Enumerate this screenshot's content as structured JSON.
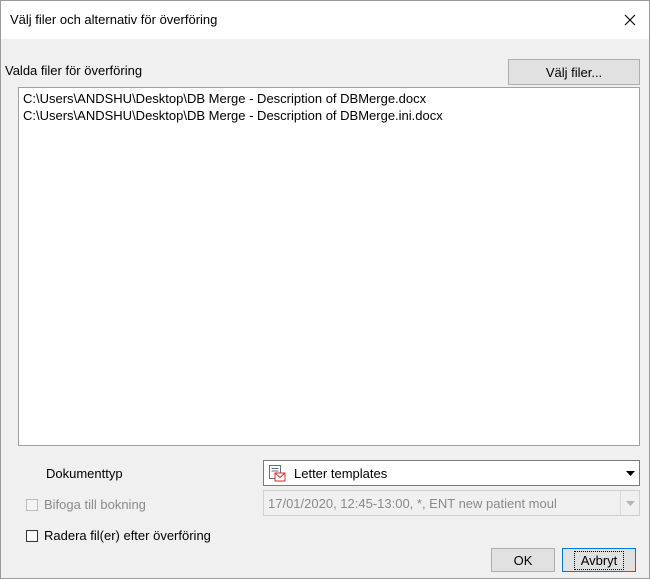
{
  "window": {
    "title": "Välj filer och alternativ för överföring",
    "close_icon": "close-icon"
  },
  "files": {
    "label": "Valda filer för överföring",
    "choose_button": "Välj filer...",
    "items": [
      "C:\\Users\\ANDSHU\\Desktop\\DB Merge - Description of DBMerge.docx",
      "C:\\Users\\ANDSHU\\Desktop\\DB Merge - Description of DBMerge.ini.docx"
    ]
  },
  "doctype": {
    "label": "Dokumenttyp",
    "selected": "Letter templates",
    "icon": "letter-template-icon"
  },
  "attach": {
    "label": "Bifoga till bokning",
    "checked": false,
    "disabled": true,
    "booking_selected": "17/01/2020, 12:45-13:00, *, ENT new patient moul"
  },
  "delete_after": {
    "label": "Radera fil(er) efter överföring",
    "checked": false
  },
  "buttons": {
    "ok": "OK",
    "cancel": "Avbryt"
  }
}
